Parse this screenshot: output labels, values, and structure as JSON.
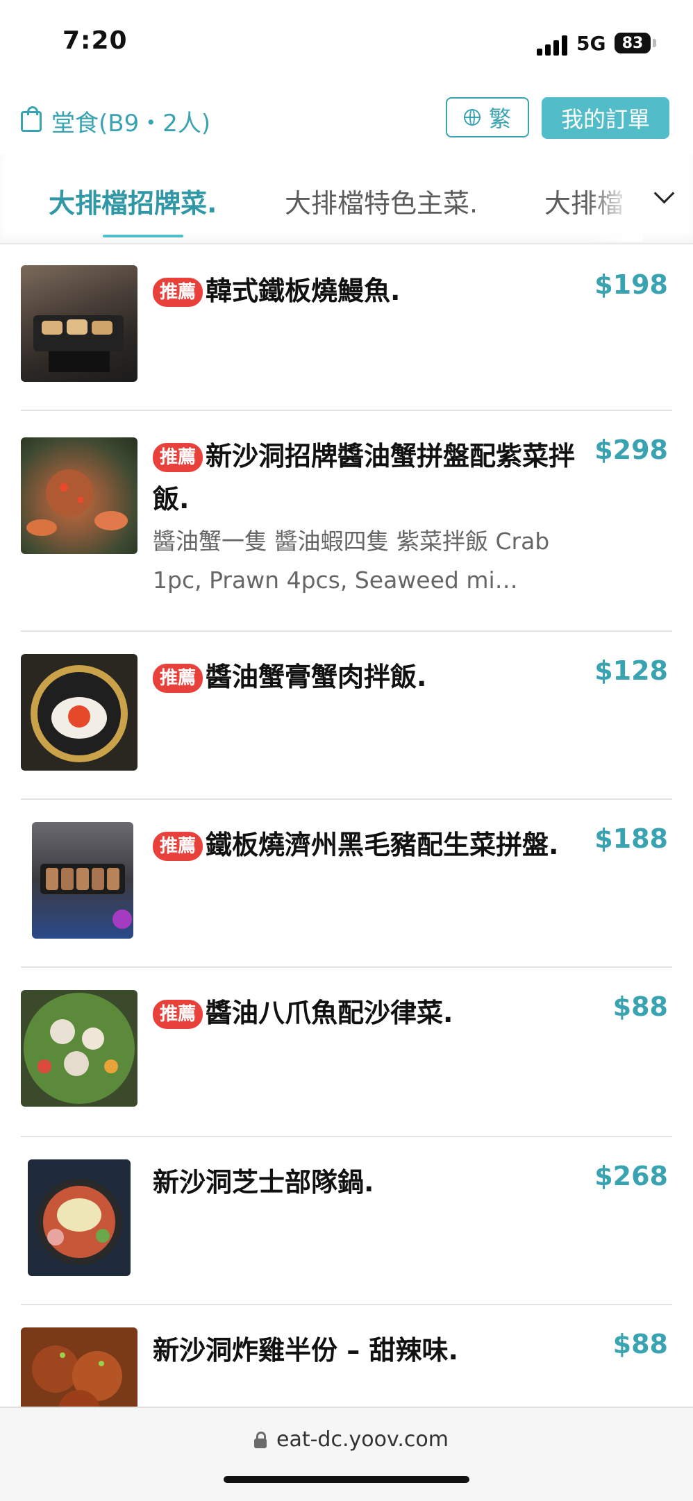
{
  "status_bar": {
    "time": "7:20",
    "network": "5G",
    "battery": "83"
  },
  "header": {
    "dining_mode": "堂食(B9・2人)",
    "language_button": "繁",
    "orders_button": "我的訂單"
  },
  "tabs": [
    "大排檔招牌菜.",
    "大排檔特色主菜.",
    "大排檔"
  ],
  "badge_text": "推薦",
  "menu_items": [
    {
      "recommended": true,
      "name": "韓式鐵板燒鰻魚.",
      "description": "",
      "price": "$198"
    },
    {
      "recommended": true,
      "name": "新沙洞招牌醬油蟹拼盤配紫菜拌飯.",
      "description": "醬油蟹一隻 醬油蝦四隻 紫菜拌飯 Crab 1pc, Prawn 4pcs, Seaweed mi…",
      "price": "$298"
    },
    {
      "recommended": true,
      "name": "醬油蟹膏蟹肉拌飯.",
      "description": "",
      "price": "$128"
    },
    {
      "recommended": true,
      "name": "鐵板燒濟州黑毛豬配生菜拼盤.",
      "description": "",
      "price": "$188"
    },
    {
      "recommended": true,
      "name": "醬油八爪魚配沙律菜.",
      "description": "",
      "price": "$88"
    },
    {
      "recommended": false,
      "name": "新沙洞芝士部隊鍋.",
      "description": "",
      "price": "$268"
    },
    {
      "recommended": false,
      "name": "新沙洞炸雞半份 – 甜辣味.",
      "description": "",
      "price": "$88"
    }
  ],
  "browser": {
    "url": "eat-dc.yoov.com"
  },
  "colors": {
    "accent": "#3aa3b2",
    "accent_button": "#53bcc9",
    "badge": "#e8403a"
  }
}
